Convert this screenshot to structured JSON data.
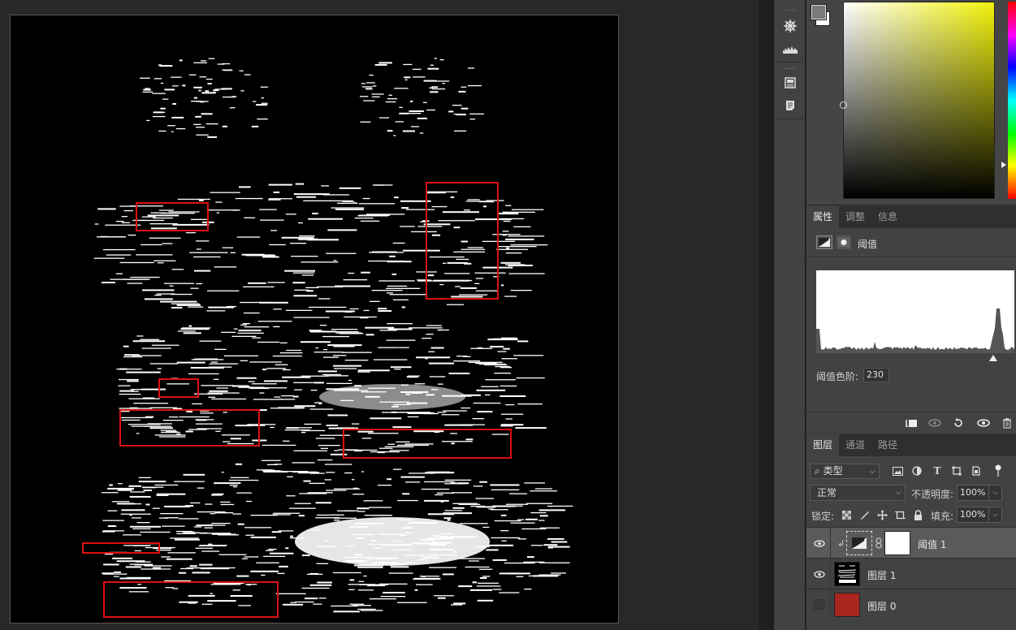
{
  "properties_panel": {
    "tabs": [
      "属性",
      "调整",
      "信息"
    ],
    "adjustment_name": "阈值",
    "threshold_label": "阈值色阶:",
    "threshold_value": "230"
  },
  "layers_panel": {
    "tabs": [
      "图层",
      "通道",
      "路径"
    ],
    "filter_kind": "类型",
    "blend_mode": "正常",
    "opacity_label": "不透明度:",
    "opacity_value": "100%",
    "lock_label": "锁定:",
    "fill_label": "填充:",
    "fill_value": "100%",
    "layers": [
      {
        "name": "阈值 1",
        "visible": true,
        "selected": true
      },
      {
        "name": "图层 1",
        "visible": true,
        "selected": false
      },
      {
        "name": "图层 0",
        "visible": false,
        "selected": false
      }
    ]
  },
  "colors": {
    "annotation_box": "#e01010",
    "layer0_thumb": "#a8261f",
    "foreground": "#7a7a7a",
    "background": "#ffffff"
  }
}
